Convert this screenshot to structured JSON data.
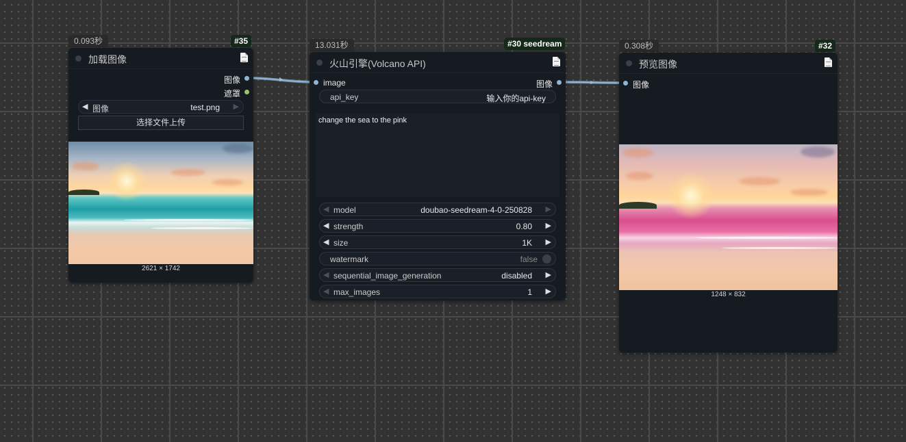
{
  "nodes": {
    "load_image": {
      "timer": "0.093秒",
      "badge": "#35",
      "title": "加载图像",
      "outputs": [
        "图像",
        "遮罩"
      ],
      "image_widget": {
        "label": "图像",
        "value": "test.png"
      },
      "upload_label": "选择文件上传",
      "image_dims": "2621 × 1742"
    },
    "volcano": {
      "timer": "13.031秒",
      "badge": "#30 seedream",
      "title": "火山引擎(Volcano API)",
      "input_label": "image",
      "output_label": "图像",
      "api_key": {
        "label": "api_key",
        "value": "输入你的api-key"
      },
      "prompt": "change the sea to the pink",
      "widgets": [
        {
          "label": "model",
          "value": "doubao-seedream-4-0-250828"
        },
        {
          "label": "strength",
          "value": "0.80"
        },
        {
          "label": "size",
          "value": "1K"
        },
        {
          "label": "watermark",
          "value": "false"
        },
        {
          "label": "sequential_image_generation",
          "value": "disabled"
        },
        {
          "label": "max_images",
          "value": "1"
        }
      ]
    },
    "preview": {
      "timer": "0.308秒",
      "badge": "#32",
      "title": "预览图像",
      "input_label": "图像",
      "image_dims": "1248 × 832"
    }
  },
  "icons": {
    "node_doc": "document-icon",
    "arrow_left": "◀",
    "arrow_right": "▶"
  },
  "colors": {
    "canvas": "#323232",
    "node_bg": "#161a21",
    "badge_bg": "#15291a",
    "image_port": "#8fb4d6",
    "mask_port": "#9ac46a",
    "wire": "#8fb4d6"
  }
}
